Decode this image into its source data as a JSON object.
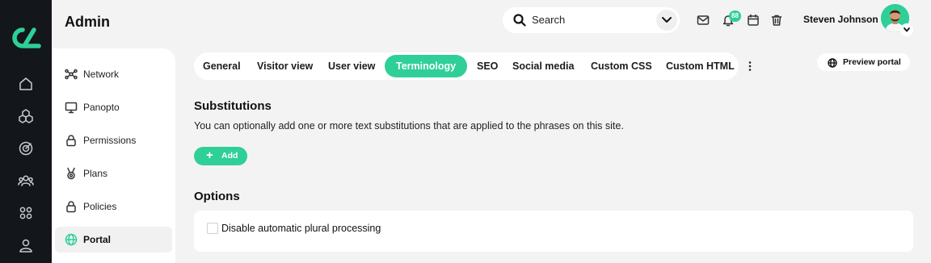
{
  "header": {
    "title": "Admin",
    "search_placeholder": "Search",
    "notification_count": "88",
    "user_name": "Steven Johnson"
  },
  "rail": {
    "icons": [
      "home-icon",
      "cubes-icon",
      "target-icon",
      "users-icon",
      "apps-grid-icon",
      "user-icon"
    ]
  },
  "subnav": {
    "items": [
      {
        "label": "Network",
        "icon": "network-icon"
      },
      {
        "label": "Panopto",
        "icon": "monitor-icon"
      },
      {
        "label": "Permissions",
        "icon": "lock-icon"
      },
      {
        "label": "Plans",
        "icon": "medal-icon"
      },
      {
        "label": "Policies",
        "icon": "lock-icon"
      },
      {
        "label": "Portal",
        "icon": "globe-icon",
        "active": true
      }
    ]
  },
  "tabs": {
    "items": [
      "General",
      "Visitor view",
      "User view",
      "Terminology",
      "SEO",
      "Social media",
      "Custom CSS",
      "Custom HTML"
    ],
    "active": "Terminology"
  },
  "preview_button": "Preview portal",
  "substitutions": {
    "title": "Substitutions",
    "description": "You can optionally add one or more text substitutions that are applied to the phrases on this site.",
    "add_label": "Add"
  },
  "options": {
    "title": "Options",
    "checkbox_label": "Disable automatic plural processing",
    "checked": false
  },
  "colors": {
    "accent": "#2fcf98",
    "rail": "#13161b",
    "background": "#f3f3f3"
  }
}
